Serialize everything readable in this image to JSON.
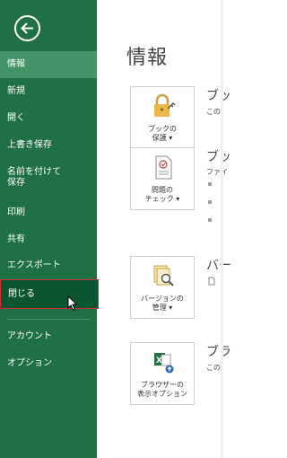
{
  "nav": {
    "back_label": "戻る",
    "items": [
      {
        "label": "情報"
      },
      {
        "label": "新規"
      },
      {
        "label": "開く"
      },
      {
        "label": "上書き保存"
      },
      {
        "label_line1": "名前を付けて",
        "label_line2": "保存"
      },
      {
        "label": "印刷"
      },
      {
        "label": "共有"
      },
      {
        "label": "エクスポート"
      },
      {
        "label": "閉じる"
      },
      {
        "label": "アカウント"
      },
      {
        "label": "オプション"
      }
    ],
    "active": "情報",
    "hovered": "閉じる"
  },
  "main": {
    "title": "情報",
    "sections": [
      {
        "button_line1": "ブックの",
        "button_line2": "保護",
        "title": "ブッ",
        "desc": "この"
      },
      {
        "button_line1": "問題の",
        "button_line2": "チェック",
        "title": "ブッ",
        "desc": "ファイ"
      },
      {
        "button_line1": "バージョンの",
        "button_line2": "管理",
        "title": "バー",
        "desc": ""
      },
      {
        "button_line1": "ブラウザーの",
        "button_line2": "表示オプション",
        "title": "ブラ",
        "desc": "この"
      }
    ]
  },
  "colors": {
    "sidebar_bg": "#1f7145",
    "active_item_bg": "#439467",
    "hovered_item_bg": "#0b5530",
    "hover_border": "#d03030"
  }
}
